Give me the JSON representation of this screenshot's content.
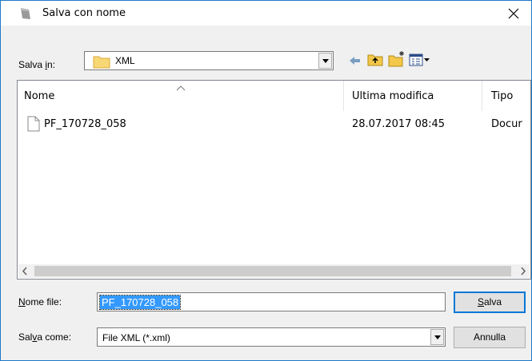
{
  "window": {
    "title": "Salva con nome",
    "close_glyph": "×"
  },
  "lookin": {
    "label_pre": "Salva ",
    "label_accel": "i",
    "label_post": "n:",
    "value": "XML"
  },
  "toolbar": {
    "icons": [
      "back-arrow-icon",
      "up-folder-icon",
      "new-folder-icon",
      "view-menu-icon"
    ]
  },
  "filelist": {
    "columns": [
      "Nome",
      "Ultima modifica",
      "Tipo"
    ],
    "rows": [
      {
        "name": "PF_170728_058",
        "modified": "28.07.2017 08:45",
        "type": "Docur"
      }
    ]
  },
  "filename": {
    "label_accel": "N",
    "label_rest": "ome file:",
    "value": "PF_170728_058"
  },
  "savetype": {
    "label_pre": "Sal",
    "label_accel": "v",
    "label_post": "a come:",
    "value": "File XML (*.xml)"
  },
  "buttons": {
    "save_accel": "S",
    "save_rest": "alva",
    "cancel": "Annulla"
  },
  "colors": {
    "accent": "#0078d7",
    "selection": "#3399ff",
    "border": "#1f7ac9"
  }
}
